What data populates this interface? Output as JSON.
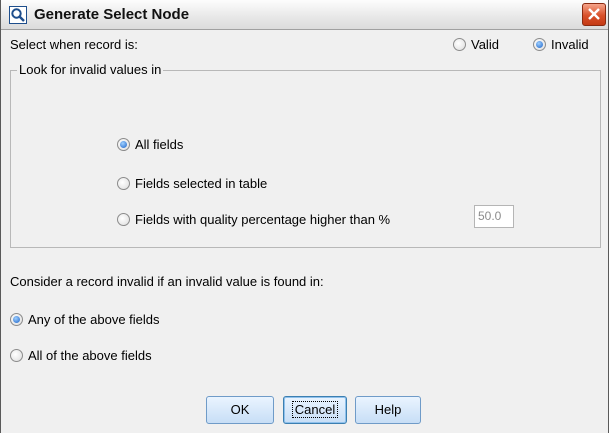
{
  "window": {
    "title": "Generate Select Node"
  },
  "select_when": {
    "label": "Select when record is:",
    "options": [
      {
        "label": "Valid",
        "selected": false
      },
      {
        "label": "Invalid",
        "selected": true
      }
    ]
  },
  "look_for": {
    "legend": "Look for invalid values in",
    "options": [
      {
        "label": "All fields",
        "selected": true
      },
      {
        "label": "Fields selected in table",
        "selected": false
      },
      {
        "label": "Fields with quality percentage higher than %",
        "selected": false
      }
    ],
    "percentage_value": "50.0"
  },
  "consider": {
    "label": "Consider a record invalid if an invalid value is found in:",
    "options": [
      {
        "label": "Any of the above fields",
        "selected": true
      },
      {
        "label": "All of the above fields",
        "selected": false
      }
    ]
  },
  "buttons": {
    "ok": "OK",
    "cancel": "Cancel",
    "help": "Help"
  },
  "colors": {
    "close_button": "#d8502a",
    "radio_selected": "#1b62c8",
    "button_face": "#c7def6"
  }
}
